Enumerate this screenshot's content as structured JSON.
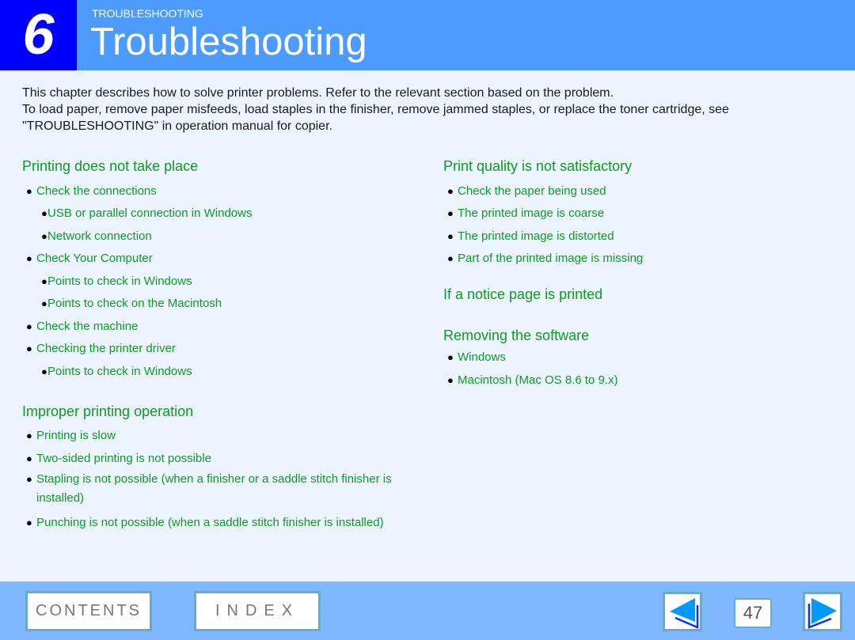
{
  "header": {
    "chapter_number": "6",
    "section_label": "TROUBLESHOOTING",
    "title": "Troubleshooting"
  },
  "intro": {
    "line1": "This chapter describes how to solve printer problems. Refer to the relevant section based on the problem.",
    "line2": "To load paper, remove paper misfeeds, load staples in the finisher, remove jammed staples, or replace the toner cartridge, see \"TROUBLESHOOTING\" in operation manual for copier."
  },
  "bullet_glyph": "●",
  "left_column": {
    "sections": [
      {
        "title": "Printing does not take place",
        "items": [
          {
            "label": "Check the connections",
            "level": 1
          },
          {
            "label": "USB or parallel connection in Windows",
            "level": 2
          },
          {
            "label": "Network connection",
            "level": 2
          },
          {
            "label": "Check Your Computer",
            "level": 1
          },
          {
            "label": "Points to check in Windows",
            "level": 2
          },
          {
            "label": "Points to check on the Macintosh",
            "level": 2
          },
          {
            "label": "Check the machine",
            "level": 1
          },
          {
            "label": "Checking the printer driver",
            "level": 1
          },
          {
            "label": "Points to check in Windows",
            "level": 2
          }
        ]
      },
      {
        "title": "Improper printing operation",
        "items": [
          {
            "label": "Printing is slow",
            "level": 1
          },
          {
            "label": "Two-sided printing is not possible",
            "level": 1
          },
          {
            "label": "Stapling is not possible (when a finisher or a saddle stitch finisher is installed)",
            "level": 1
          },
          {
            "label": "Punching is not possible (when a saddle stitch finisher is installed)",
            "level": 1
          }
        ]
      }
    ]
  },
  "right_column": {
    "sections": [
      {
        "title": "Print quality is not satisfactory",
        "items": [
          {
            "label": "Check the paper being used",
            "level": 1
          },
          {
            "label": "The printed image is coarse",
            "level": 1
          },
          {
            "label": "The printed image is distorted",
            "level": 1
          },
          {
            "label": "Part of the printed image is missing",
            "level": 1
          }
        ]
      },
      {
        "title": "If a notice page is printed",
        "items": []
      },
      {
        "title": "Removing the software",
        "items": [
          {
            "label": "Windows",
            "level": 1
          },
          {
            "label": "Macintosh (Mac OS 8.6 to 9.x)",
            "level": 1
          }
        ]
      }
    ]
  },
  "footer": {
    "contents_label": "CONTENTS",
    "index_label": "INDEX",
    "page_number": "47",
    "prev_icon": "left-triangle-arrow",
    "next_icon": "right-triangle-arrow"
  },
  "colors": {
    "header_bg": "#4d9bff",
    "chapter_box": "#0000ff",
    "page_bg": "#ecf4ff",
    "link_green": "#119922",
    "footer_bg": "#80b8ff",
    "arrow_fill": "#0099ff"
  }
}
